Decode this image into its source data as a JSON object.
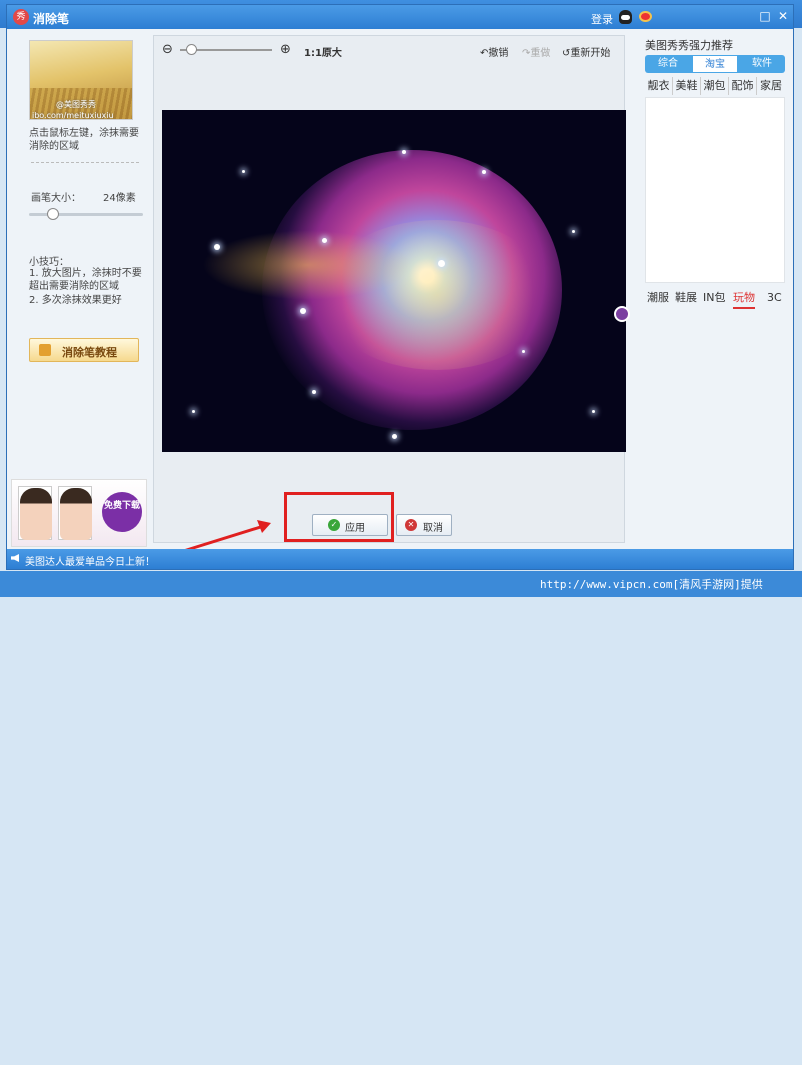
{
  "window": {
    "title": "消除笔",
    "login": "登录"
  },
  "left": {
    "thumb_watermark_top": "@美图秀秀",
    "thumb_watermark_bottom": "ibo.com/meituxiuxiu",
    "hint": "点击鼠标左键，涂抹需要消除的区域",
    "brush_label": "画笔大小：",
    "brush_value": "24像素",
    "tips_title": "小技巧：",
    "tip1": "1. 放大图片，涂抹时不要超出需要消除的区域",
    "tip2": "2. 多次涂抹效果更好",
    "tutorial_label": "消除笔教程",
    "ad_label": "免费下载"
  },
  "toolbar": {
    "zoom_value": "1:1原大",
    "undo": "撤销",
    "redo": "重做",
    "restart": "重新开始"
  },
  "actions": {
    "apply": "应用",
    "cancel": "取消"
  },
  "right": {
    "title": "美图秀秀强力推荐",
    "tabs": [
      "综合",
      "淘宝",
      "软件"
    ],
    "active_tab": "淘宝",
    "categories": [
      "靓衣",
      "美鞋",
      "潮包",
      "配饰",
      "家居"
    ],
    "subtabs": [
      "潮服",
      "鞋展",
      "IN包",
      "玩物",
      "3C"
    ],
    "active_subtab": "玩物"
  },
  "status": {
    "text": "美图达人最爱单品今日上新！"
  },
  "page_watermark": "http://www.vipcn.com[清风手游网]提供",
  "colors": {
    "titlebar": "#2d7ed3",
    "highlight": "#e02020",
    "apply_check": "#3aa63a",
    "cancel_x": "#d03838"
  }
}
